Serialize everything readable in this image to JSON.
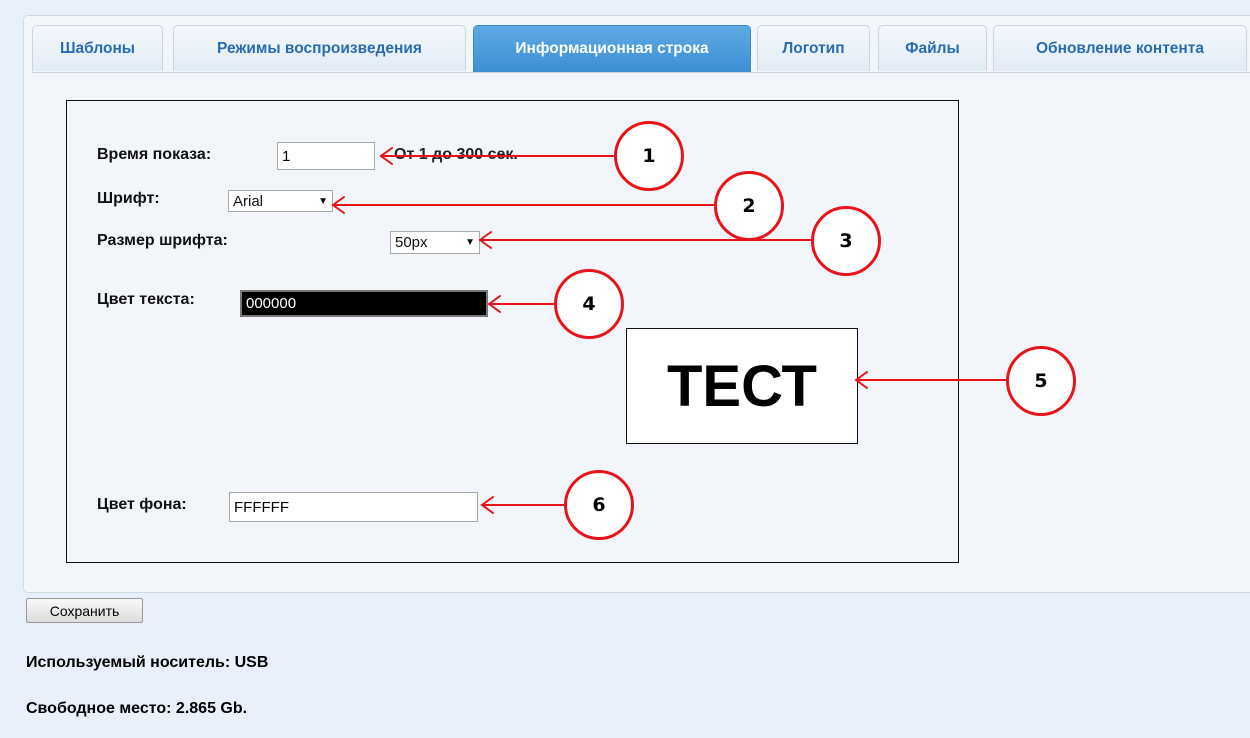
{
  "tabs": [
    {
      "label": "Шаблоны",
      "active": false
    },
    {
      "label": "Режимы воспроизведения",
      "active": false
    },
    {
      "label": "Информационная строка",
      "active": true
    },
    {
      "label": "Логотип",
      "active": false
    },
    {
      "label": "Файлы",
      "active": false
    },
    {
      "label": "Обновление контента",
      "active": false
    }
  ],
  "form": {
    "show_time": {
      "label": "Время показа:",
      "value": "1",
      "hint": "От 1 до 300 сек."
    },
    "font": {
      "label": "Шрифт:",
      "value": "Arial"
    },
    "font_size": {
      "label": "Размер шрифта:",
      "value": "50px"
    },
    "text_color": {
      "label": "Цвет текста:",
      "value": "000000"
    },
    "bg_color": {
      "label": "Цвет фона:",
      "value": "FFFFFF"
    }
  },
  "preview": {
    "text": "ТЕСТ"
  },
  "markers": [
    "1",
    "2",
    "3",
    "4",
    "5",
    "6"
  ],
  "save_label": "Сохранить",
  "footer": {
    "media": "Используемый носитель: USB",
    "free_space": "Свободное место: 2.865 Gb."
  },
  "colors": {
    "active_tab": "#4a9bdb",
    "tab_text": "#2b6cb0",
    "annotation": "#e8141b",
    "page_bg": "#e8f1fb"
  }
}
